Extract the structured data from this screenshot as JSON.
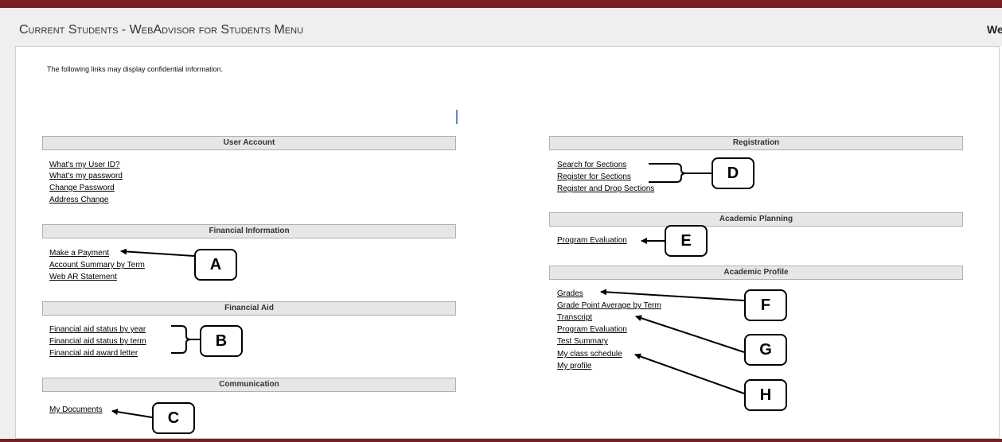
{
  "header": {
    "title": "Current Students - WebAdvisor for Students Menu",
    "welcome_fragment": "We"
  },
  "notice": "The following links may display confidential information.",
  "sections": {
    "user_account": {
      "title": "User Account",
      "links": [
        "What's my User ID?",
        "What's my password",
        "Change Password",
        "Address Change"
      ]
    },
    "financial_information": {
      "title": "Financial Information",
      "links": [
        "Make a Payment",
        "Account Summary by Term",
        "Web AR Statement"
      ]
    },
    "financial_aid": {
      "title": "Financial Aid",
      "links": [
        "Financial aid status by year",
        "Financial aid status by term",
        "Financial aid award letter"
      ]
    },
    "communication": {
      "title": "Communication",
      "links": [
        "My Documents"
      ]
    },
    "registration": {
      "title": "Registration",
      "links": [
        "Search for Sections",
        "Register for Sections",
        "Register and Drop Sections"
      ]
    },
    "academic_planning": {
      "title": "Academic Planning",
      "links": [
        "Program Evaluation"
      ]
    },
    "academic_profile": {
      "title": "Academic Profile",
      "links": [
        "Grades",
        "Grade Point Average by Term",
        "Transcript",
        "Program Evaluation",
        "Test Summary",
        "My class schedule",
        "My profile"
      ]
    }
  },
  "callouts": [
    "A",
    "B",
    "C",
    "D",
    "E",
    "F",
    "G",
    "H"
  ],
  "colors": {
    "brand_bar": "#7a1e23",
    "section_header_bg": "#e6e6e6",
    "header_bg": "#efefef"
  }
}
